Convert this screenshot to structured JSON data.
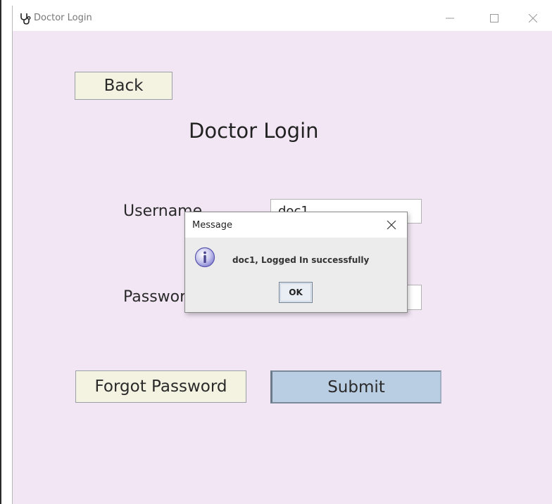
{
  "window": {
    "title": "Doctor Login",
    "icon": "stethoscope-icon",
    "controls": [
      "minimize-icon",
      "maximize-icon",
      "close-icon"
    ]
  },
  "form": {
    "back_label": "Back",
    "heading": "Doctor Login",
    "username_label": "Username",
    "username_value": "doc1",
    "password_label": "Password",
    "password_value": "",
    "forgot_label": "Forgot Password",
    "submit_label": "Submit"
  },
  "dialog": {
    "title": "Message",
    "icon": "info-icon",
    "message": "doc1, Logged In successfully",
    "ok_label": "OK"
  },
  "colors": {
    "window_background": "#f2e6f4",
    "button_background": "#f4f2e1",
    "submit_background": "#b9cee3"
  }
}
